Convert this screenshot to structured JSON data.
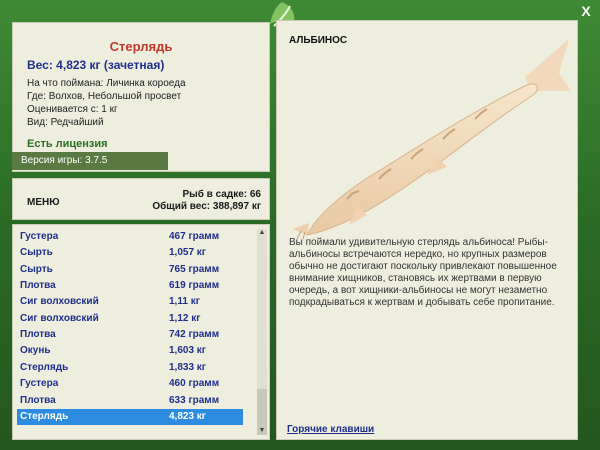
{
  "window": {
    "close_label": "X"
  },
  "fish_info": {
    "name": "Стерлядь",
    "weight": "Вес: 4,823 кг (зачетная)",
    "details": [
      "На что поймана: Личинка короеда",
      "Где: Волхов, Небольшой просвет",
      "Оценивается с: 1 кг",
      "Вид: Редчайший"
    ],
    "license": "Есть лицензия",
    "version": "Версия игры: 3.7.5"
  },
  "menu": {
    "label": "МЕНЮ",
    "fish_in_keepnet": "Рыб в садке: 66",
    "total_weight": "Общий вес: 388,897 кг"
  },
  "catch_list": [
    {
      "name": "Густера",
      "weight": "467 грамм",
      "selected": false
    },
    {
      "name": "Сырть",
      "weight": "1,057 кг",
      "selected": false
    },
    {
      "name": "Сырть",
      "weight": "765 грамм",
      "selected": false
    },
    {
      "name": "Плотва",
      "weight": "619 грамм",
      "selected": false
    },
    {
      "name": "Сиг волховский",
      "weight": "1,11 кг",
      "selected": false
    },
    {
      "name": "Сиг волховский",
      "weight": "1,12 кг",
      "selected": false
    },
    {
      "name": "Плотва",
      "weight": "742 грамм",
      "selected": false
    },
    {
      "name": "Окунь",
      "weight": "1,603 кг",
      "selected": false
    },
    {
      "name": "Стерлядь",
      "weight": "1,833 кг",
      "selected": false
    },
    {
      "name": "Густера",
      "weight": "460 грамм",
      "selected": false
    },
    {
      "name": "Плотва",
      "weight": "633 грамм",
      "selected": false
    },
    {
      "name": "Стерлядь",
      "weight": "4,823 кг",
      "selected": true
    }
  ],
  "right_panel": {
    "albino_label": "АЛЬБИНОС",
    "description": "Вы поймали удивительную стерлядь альбиноса! Рыбы-альбиносы встречаются нередко, но крупных размеров обычно не достигают поскольку привлекают повышенное внимание хищников, становясь их жертвами в первую очередь, а вот хищники-альбиносы не могут незаметно подкрадываться к жертвам и добывать себе пропитание.",
    "hotkeys": "Горячие клавиши"
  },
  "colors": {
    "frame_green": "#2f6b2a",
    "panel_bg": "#eeeede",
    "fish_name_red": "#c0392b",
    "text_blue": "#1f2e8c",
    "selected_row": "#2d8be0"
  },
  "icons": {
    "logo": "leaf-fish-logo-icon",
    "close": "close-icon"
  }
}
